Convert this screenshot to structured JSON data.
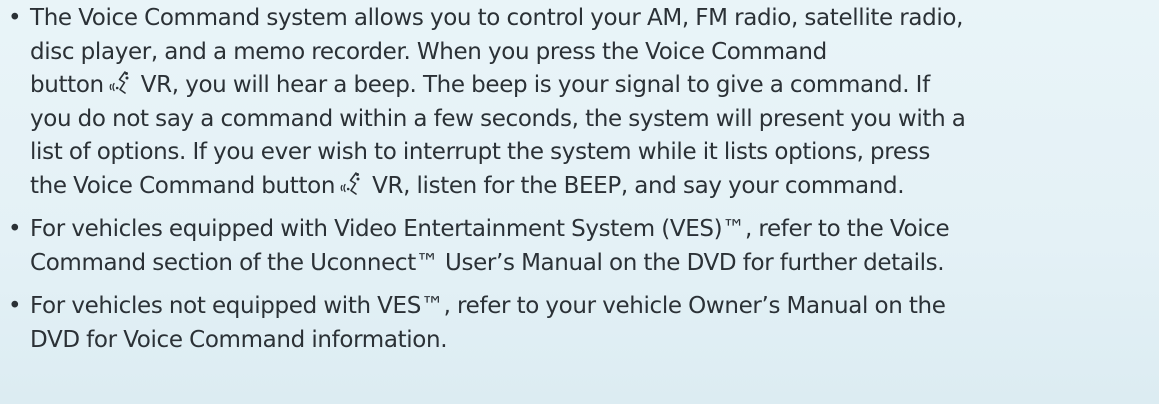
{
  "bullets": [
    {
      "lines": [
        "The Voice Command system allows you to control your AM, FM radio, satellite radio,",
        "disc player, and a memo recorder. When you press the Voice Command"
      ],
      "line3_before": "button",
      "line3_after": ", you will hear a beep. The beep is your signal to give a command. If",
      "lines_mid": [
        "you do not say a command within a few seconds, the system will present you with a",
        "list of options. If you ever wish to interrupt the system while it lists options, press"
      ],
      "line6_before": "the Voice Command button",
      "line6_after": ", listen for the BEEP, and say your command."
    },
    {
      "lines": [
        "For vehicles equipped with Video Entertainment System (VES)™, refer to the Voice",
        "Command section of the Uconnect™ User’s Manual on the DVD for further details."
      ]
    },
    {
      "lines": [
        "For vehicles not equipped with VES™, refer to your vehicle Owner’s Manual on the",
        "DVD for Voice Command information."
      ]
    }
  ],
  "vr_button": {
    "icon": "voice-command-icon",
    "label": "VR"
  }
}
